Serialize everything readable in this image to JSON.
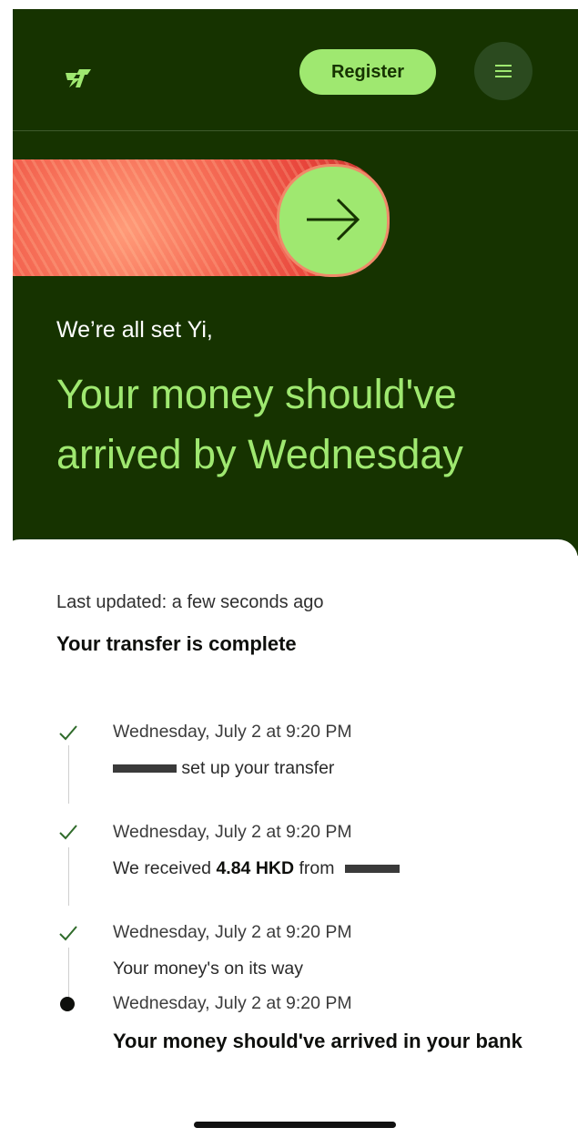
{
  "header": {
    "logo_text": "ꟷ7",
    "register_label": "Register",
    "menu_icon": "hamburger-icon"
  },
  "hero": {
    "banner_icon": "arrow-right-icon",
    "greeting": "We’re all set Yi,",
    "headline": "Your money should've arrived by Wednesday"
  },
  "status": {
    "last_updated": "Last updated: a few seconds ago",
    "title": "Your transfer is complete"
  },
  "timeline": [
    {
      "date": "Wednesday, July 2 at 9:20 PM",
      "description": "set up your transfer",
      "state": "done"
    },
    {
      "date": "Wednesday, July 2 at 9:20 PM",
      "description_prefix": "We received ",
      "amount": "4.84 HKD",
      "description_suffix": " from",
      "state": "done"
    },
    {
      "date": "Wednesday, July 2 at 9:20 PM",
      "description": "Your money's on its way",
      "state": "done"
    },
    {
      "date": "Wednesday, July 2 at 9:20 PM",
      "description": "Your money should've arrived in your bank",
      "state": "current"
    }
  ],
  "colors": {
    "brand_dark": "#163300",
    "brand_green": "#9fe870",
    "banner_red": "#f66d56"
  }
}
